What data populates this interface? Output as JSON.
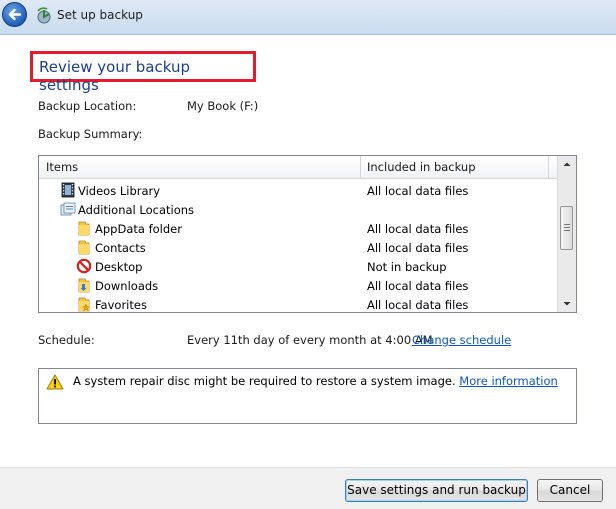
{
  "window": {
    "title": "Set up backup"
  },
  "page": {
    "title": "Review your backup settings"
  },
  "location": {
    "label": "Backup Location:",
    "value": "My Book (F:)"
  },
  "summary": {
    "label": "Backup Summary:"
  },
  "table": {
    "columns": [
      "Items",
      "Included in backup"
    ],
    "rows": [
      {
        "name": "Videos Library",
        "included": "All local data files",
        "icon": "videos-library-icon"
      },
      {
        "name": "Additional Locations",
        "included": "",
        "icon": "additional-locations-icon"
      },
      {
        "name": "AppData folder",
        "included": "All local data files",
        "icon": "folder-icon"
      },
      {
        "name": "Contacts",
        "included": "All local data files",
        "icon": "folder-icon"
      },
      {
        "name": "Desktop",
        "included": "Not in backup",
        "icon": "excluded-icon"
      },
      {
        "name": "Downloads",
        "included": "All local data files",
        "icon": "downloads-folder-icon"
      },
      {
        "name": "Favorites",
        "included": "All local data files",
        "icon": "favorites-folder-icon"
      }
    ]
  },
  "schedule": {
    "label": "Schedule:",
    "value": "Every 11th day of every month at 4:00 AM",
    "change_link": "Change schedule"
  },
  "warning": {
    "text": "A system repair disc might be required to restore a system image.",
    "link": "More information"
  },
  "buttons": {
    "save": "Save settings and run backup",
    "cancel": "Cancel"
  },
  "colors": {
    "title_text": "#1d3f8f",
    "highlight_box": "#e8192c",
    "link": "#0b57c2"
  }
}
